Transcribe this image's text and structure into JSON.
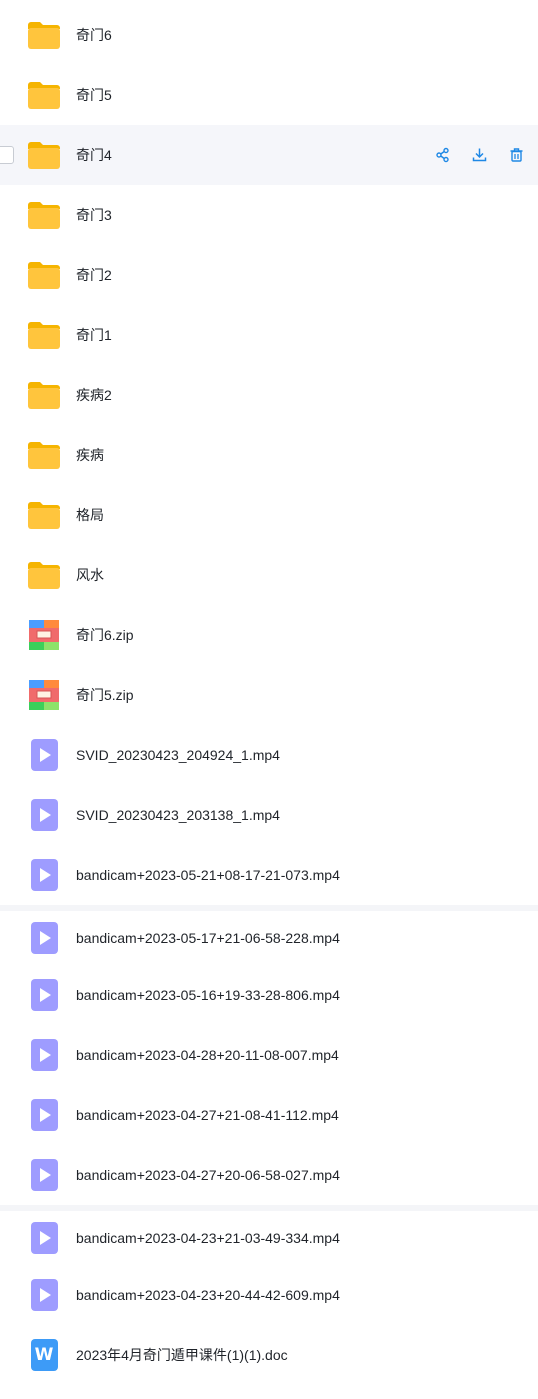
{
  "actions": {
    "share": "share-icon",
    "download": "download-icon",
    "delete": "trash-icon"
  },
  "files": [
    {
      "name": "奇门6",
      "type": "folder"
    },
    {
      "name": "奇门5",
      "type": "folder"
    },
    {
      "name": "奇门4",
      "type": "folder",
      "hovered": true
    },
    {
      "name": "奇门3",
      "type": "folder"
    },
    {
      "name": "奇门2",
      "type": "folder"
    },
    {
      "name": "奇门1",
      "type": "folder"
    },
    {
      "name": "疾病2",
      "type": "folder"
    },
    {
      "name": "疾病",
      "type": "folder"
    },
    {
      "name": "格局",
      "type": "folder"
    },
    {
      "name": "风水",
      "type": "folder"
    },
    {
      "name": "奇门6.zip",
      "type": "zip"
    },
    {
      "name": "奇门5.zip",
      "type": "zip"
    },
    {
      "name": "SVID_20230423_204924_1.mp4",
      "type": "video"
    },
    {
      "name": "SVID_20230423_203138_1.mp4",
      "type": "video"
    },
    {
      "name": "bandicam+2023-05-21+08-17-21-073.mp4",
      "type": "video"
    },
    {
      "name": "bandicam+2023-05-17+21-06-58-228.mp4",
      "type": "video"
    },
    {
      "name": "bandicam+2023-05-16+19-33-28-806.mp4",
      "type": "video"
    },
    {
      "name": "bandicam+2023-04-28+20-11-08-007.mp4",
      "type": "video"
    },
    {
      "name": "bandicam+2023-04-27+21-08-41-112.mp4",
      "type": "video"
    },
    {
      "name": "bandicam+2023-04-27+20-06-58-027.mp4",
      "type": "video"
    },
    {
      "name": "bandicam+2023-04-23+21-03-49-334.mp4",
      "type": "video"
    },
    {
      "name": "bandicam+2023-04-23+20-44-42-609.mp4",
      "type": "video"
    },
    {
      "name": "2023年4月奇门遁甲课件(1)(1).doc",
      "type": "doc"
    }
  ],
  "colors": {
    "folder": "#ffc53d",
    "video": "#9e9cff",
    "doc": "#3d9bf7",
    "action": "#1e88e5",
    "hover": "#f5f6fa"
  }
}
